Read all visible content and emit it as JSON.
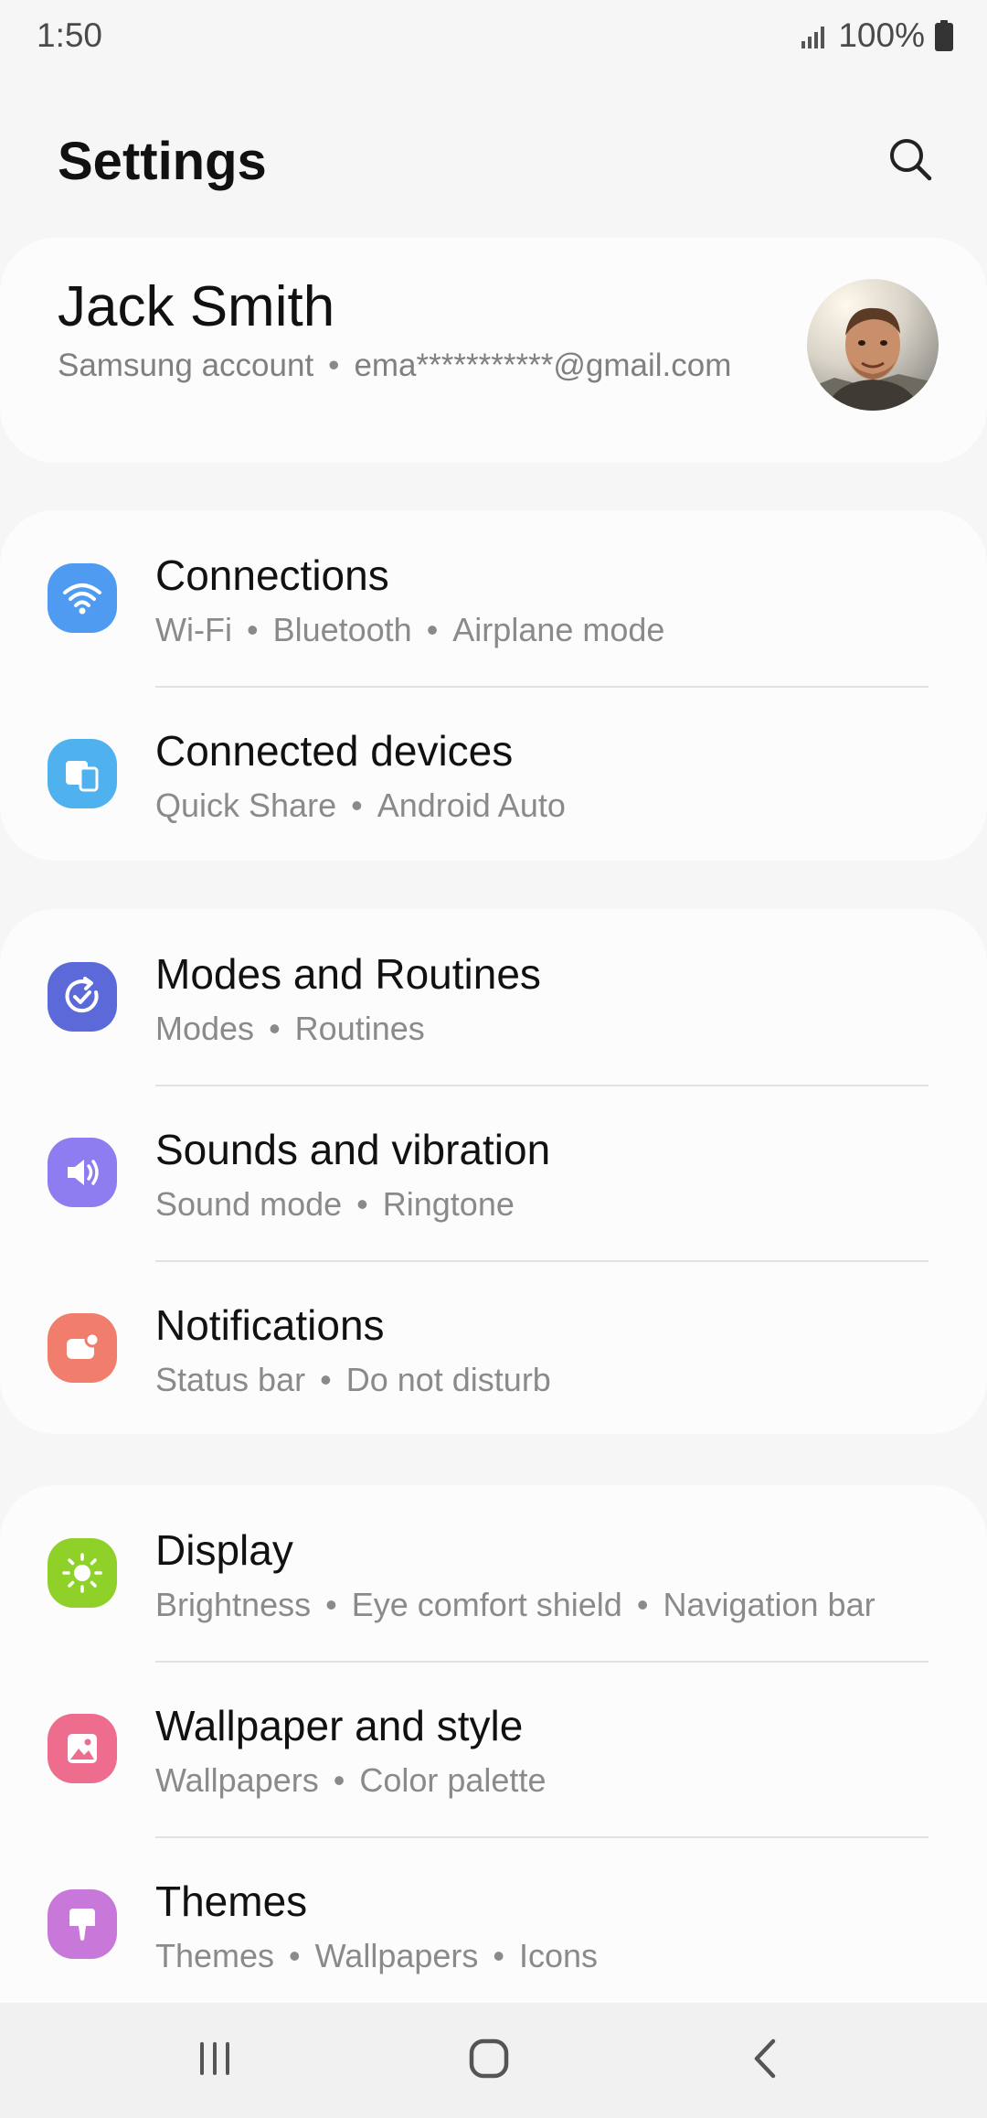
{
  "status_bar": {
    "time": "1:50",
    "battery": "100%"
  },
  "header": {
    "title": "Settings"
  },
  "account": {
    "name": "Jack Smith",
    "label": "Samsung account",
    "email": "ema***********@gmail.com"
  },
  "groups": [
    {
      "items": [
        {
          "title": "Connections",
          "subs": [
            "Wi-Fi",
            "Bluetooth",
            "Airplane mode"
          ],
          "icon": "wifi-icon",
          "color": "#4e9bf1"
        },
        {
          "title": "Connected devices",
          "subs": [
            "Quick Share",
            "Android Auto"
          ],
          "icon": "devices-icon",
          "color": "#4fb1ee"
        }
      ]
    },
    {
      "items": [
        {
          "title": "Modes and Routines",
          "subs": [
            "Modes",
            "Routines"
          ],
          "icon": "routine-check-icon",
          "color": "#5b6ad8"
        },
        {
          "title": "Sounds and vibration",
          "subs": [
            "Sound mode",
            "Ringtone"
          ],
          "icon": "speaker-icon",
          "color": "#8e7df0"
        },
        {
          "title": "Notifications",
          "subs": [
            "Status bar",
            "Do not disturb"
          ],
          "icon": "notification-icon",
          "color": "#f17d6d"
        }
      ]
    },
    {
      "items": [
        {
          "title": "Display",
          "subs": [
            "Brightness",
            "Eye comfort shield",
            "Navigation bar"
          ],
          "icon": "sun-icon",
          "color": "#8fd129"
        },
        {
          "title": "Wallpaper and style",
          "subs": [
            "Wallpapers",
            "Color palette"
          ],
          "icon": "image-icon",
          "color": "#ee6d8f"
        },
        {
          "title": "Themes",
          "subs": [
            "Themes",
            "Wallpapers",
            "Icons"
          ],
          "icon": "brush-icon",
          "color": "#c878d9"
        }
      ]
    }
  ],
  "nav": {
    "recent": "recent-apps-icon",
    "home": "home-icon",
    "back": "back-icon"
  }
}
